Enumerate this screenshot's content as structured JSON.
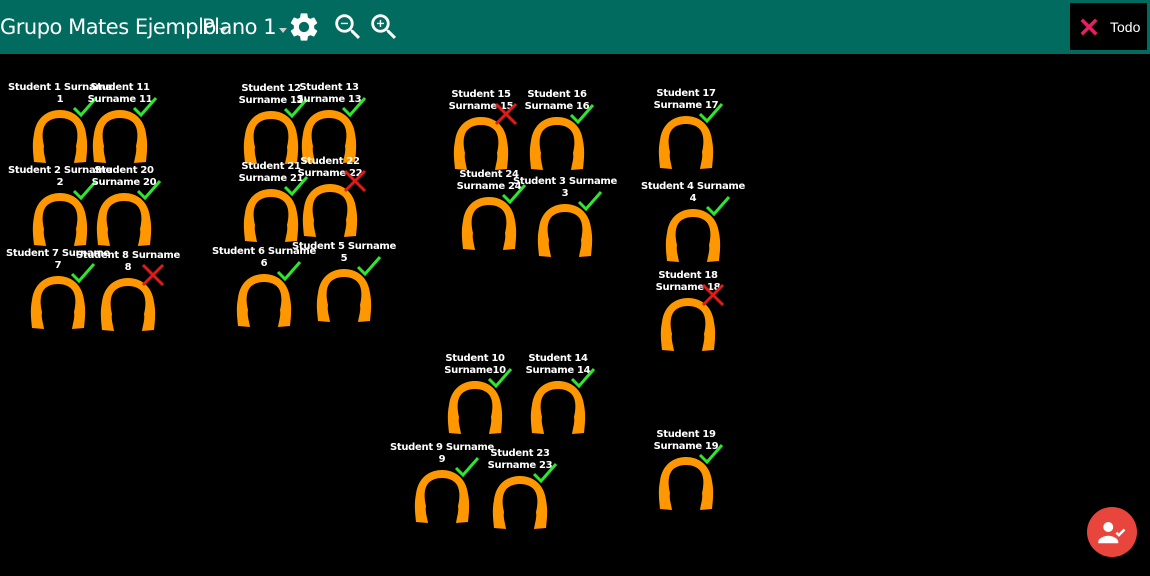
{
  "toolbar": {
    "group_label": "Grupo Mates Ejemplo",
    "plan_label": "Plano 1",
    "todo_label": "Todo"
  },
  "colors": {
    "toolbar": "#006b5e",
    "avatar": "#ff9800",
    "present": "#2ee62e",
    "absent": "#e01b1b",
    "fab": "#e8453c",
    "todo_x": "#e91e63"
  },
  "students": [
    {
      "id": "s1",
      "line1": "Student 1 Surname",
      "line2": "1",
      "status": "present"
    },
    {
      "id": "s11",
      "line1": "Student 11",
      "line2": "Surname 11",
      "status": "present"
    },
    {
      "id": "s2",
      "line1": "Student 2 Surname",
      "line2": "2",
      "status": "present"
    },
    {
      "id": "s20",
      "line1": "Student 20",
      "line2": "Surname 20",
      "status": "present"
    },
    {
      "id": "s7",
      "line1": "Student 7 Surname",
      "line2": "7",
      "status": "present"
    },
    {
      "id": "s8",
      "line1": "Student 8 Surname",
      "line2": "8",
      "status": "absent"
    },
    {
      "id": "s12",
      "line1": "Student 12",
      "line2": "Surname 12",
      "status": "present"
    },
    {
      "id": "s13",
      "line1": "Student 13",
      "line2": "Surname 13",
      "status": "present"
    },
    {
      "id": "s21",
      "line1": "Student 21",
      "line2": "Surname 21",
      "status": "present"
    },
    {
      "id": "s22",
      "line1": "Student 22",
      "line2": "Surname 22",
      "status": "absent"
    },
    {
      "id": "s6",
      "line1": "Student 6 Surname",
      "line2": "6",
      "status": "present"
    },
    {
      "id": "s5",
      "line1": "Student 5 Surname",
      "line2": "5",
      "status": "present"
    },
    {
      "id": "s15",
      "line1": "Student 15",
      "line2": "Surname 15",
      "status": "absent"
    },
    {
      "id": "s16",
      "line1": "Student 16",
      "line2": "Surname 16",
      "status": "present"
    },
    {
      "id": "s24",
      "line1": "Student 24",
      "line2": "Surname 24",
      "status": "present"
    },
    {
      "id": "s3",
      "line1": "Student 3 Surname",
      "line2": "3",
      "status": "present"
    },
    {
      "id": "s17",
      "line1": "Student 17",
      "line2": "Surname 17",
      "status": "present"
    },
    {
      "id": "s4",
      "line1": "Student 4 Surname",
      "line2": "4",
      "status": "present"
    },
    {
      "id": "s18",
      "line1": "Student 18",
      "line2": "Surname 18",
      "status": "absent"
    },
    {
      "id": "s10",
      "line1": "Student 10",
      "line2": "Surname10",
      "status": "present"
    },
    {
      "id": "s14",
      "line1": "Student 14",
      "line2": "Surname 14",
      "status": "present"
    },
    {
      "id": "s9",
      "line1": "Student 9 Surname",
      "line2": "9",
      "status": "present"
    },
    {
      "id": "s23",
      "line1": "Student 23",
      "line2": "Surname 23",
      "status": "present"
    },
    {
      "id": "s19",
      "line1": "Student 19",
      "line2": "Surname 19",
      "status": "present"
    }
  ]
}
